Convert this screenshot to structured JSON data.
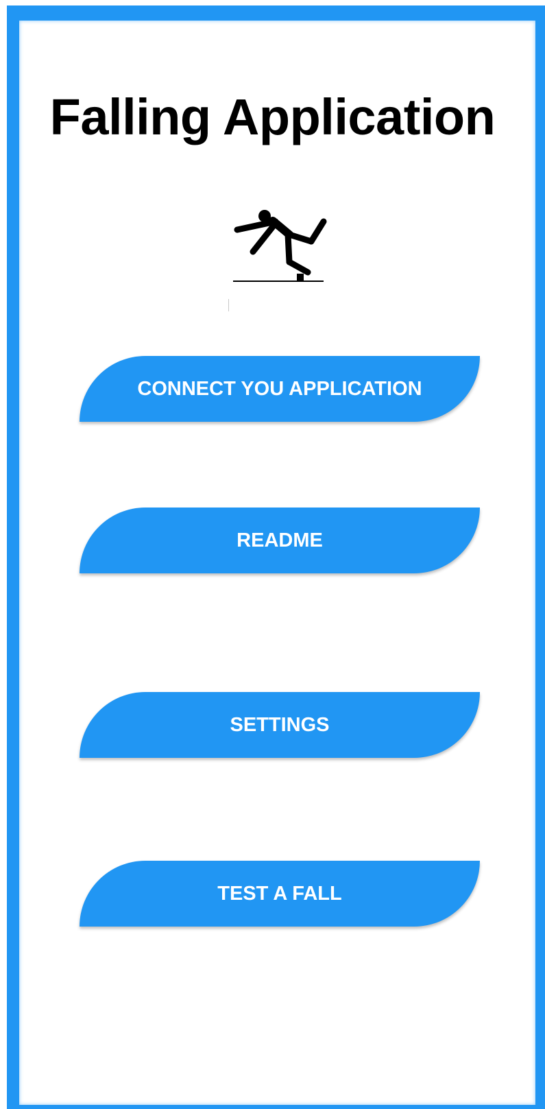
{
  "app": {
    "title": "Falling Application"
  },
  "logo": {
    "icon": "falling-person-icon"
  },
  "menu": {
    "connect_label": "CONNECT YOU APPLICATION",
    "readme_label": "README",
    "settings_label": "SETTINGS",
    "test_fall_label": "TEST A FALL"
  },
  "colors": {
    "accent": "#2196F3",
    "button_text": "#FFFFFF",
    "title_text": "#000000",
    "background": "#FFFFFF"
  }
}
